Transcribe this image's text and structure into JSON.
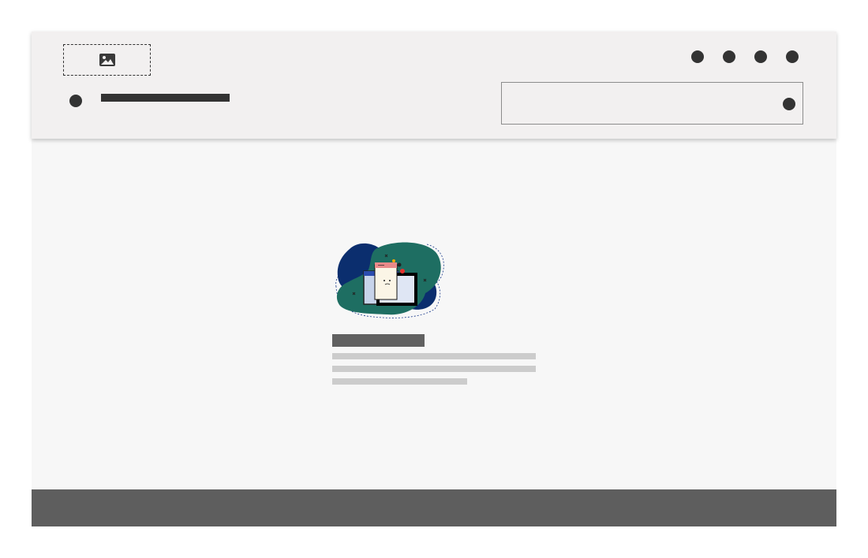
{
  "header": {
    "logo": {
      "icon": "image-icon"
    },
    "nav_icons": [
      "nav-dot",
      "nav-dot",
      "nav-dot",
      "nav-dot"
    ],
    "menu_icon": "menu-dot-icon",
    "search": {
      "value": "",
      "placeholder": "",
      "icon": "search-dot-icon"
    }
  },
  "empty_state": {
    "illustration": "empty-state-illustration",
    "title_placeholder": "",
    "text_placeholder_lines": 3
  },
  "colors": {
    "header_bg": "#f2f0f0",
    "content_bg": "#f7f7f7",
    "footer_bg": "#5e5e5e",
    "dark": "#333333",
    "placeholder_dark": "#616161",
    "placeholder_light": "#cccccc",
    "illustration_blue": "#0b2e6e",
    "illustration_teal": "#1e6e62"
  }
}
